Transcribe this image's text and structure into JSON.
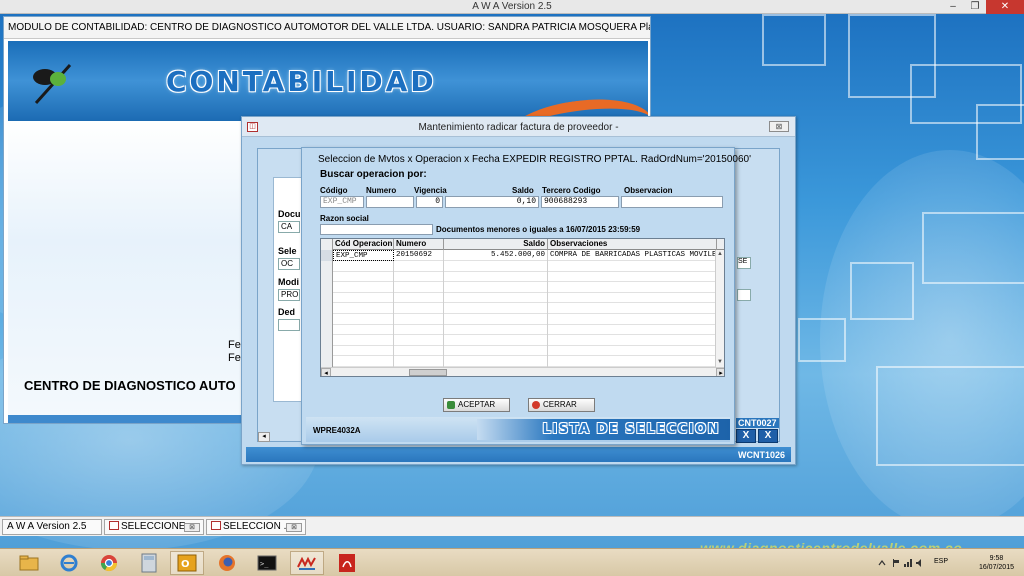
{
  "app": {
    "title": "A W A Version 2.5",
    "minimize": "–",
    "restore": "❐",
    "close": "✕"
  },
  "contabilidad": {
    "header": "MODULO DE CONTABILIDAD: CENTRO DE DIAGNOSTICO AUTOMOTOR DEL VALLE LTDA.     USUARIO:  SANDRA PATRICIA MOSQUERA  Plantilla CO...",
    "banner_word": "CONTABILIDAD",
    "company": "CENTRO DE DIAGNOSTICO AUTO",
    "fec1": "Fec",
    "fec2": "Fec"
  },
  "mantenimiento": {
    "title": "Mantenimiento radicar factura de proveedor -",
    "code": "WCNT1026",
    "close": "⊠"
  },
  "back_dialog": {
    "labels": [
      "Docum",
      "Sele",
      "Modi",
      "Ded"
    ],
    "fields": [
      "CA",
      "OC",
      "PRO"
    ],
    "right_field": "SE",
    "code": "CNT0027",
    "btn_x": "X"
  },
  "seleccion": {
    "title": "Seleccion de Mvtos x Operacion x Fecha  EXPEDIR REGISTRO PPTAL.  RadOrdNum='20150060'",
    "search_heading": "Buscar operacion por:",
    "labels": {
      "codigo": "Código",
      "numero": "Numero",
      "vigencia": "Vigencia",
      "saldo": "Saldo",
      "tercero": "Tercero Codigo",
      "observacion": "Observacion"
    },
    "values": {
      "codigo": "EXP_CMP",
      "numero": "",
      "vigencia": "0",
      "saldo": "0,10",
      "tercero": "900688293",
      "observacion": ""
    },
    "razon_label": "Razon social",
    "razon_value": "",
    "docs_note": "Documentos menores o iguales a 16/07/2015 23:59:59",
    "grid": {
      "columns": [
        "Cód Operacion",
        "Numero",
        "Saldo",
        "Observaciones"
      ],
      "rows": [
        [
          "EXP_CMP",
          "20150692",
          "5.452.000,00",
          "COMPRA DE BARRICADAS PLASTICAS MOVILE"
        ]
      ],
      "empty_rows": 11
    },
    "buttons": {
      "accept": "ACEPTAR",
      "close": "CERRAR"
    },
    "code": "WPRE4032A",
    "banner": "LISTA DE SELECCION"
  },
  "mdi_tabs": [
    {
      "label": "A W A Version 2.5"
    },
    {
      "label": "SELECCIONE..."
    },
    {
      "label": "SELECCION ..."
    }
  ],
  "taskbar": {
    "items": [
      "file-explorer-icon",
      "internet-explorer-icon",
      "chrome-icon",
      "calculator-icon",
      "outlook-icon",
      "firefox-icon",
      "terminal-icon",
      "awa-app-icon",
      "pdf-icon"
    ],
    "lang": "ESP",
    "time": "9:58",
    "date": "16/07/2015"
  },
  "watermark": "www.diagnosticentrodelvalle.com.co"
}
